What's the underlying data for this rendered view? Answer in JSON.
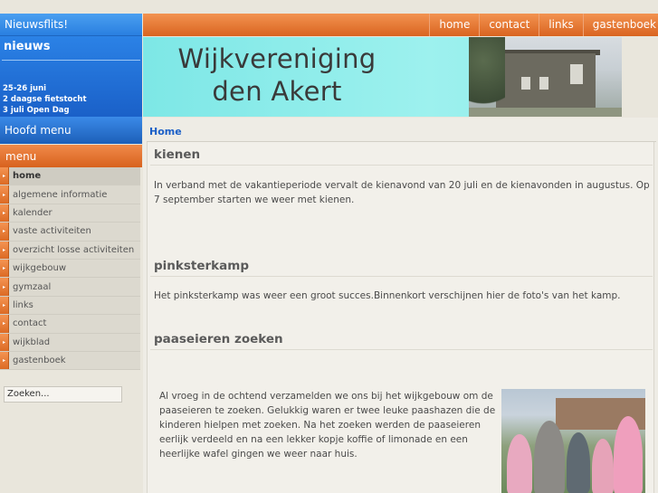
{
  "sidebar": {
    "flits_label": "Nieuwsflits!",
    "news_title": "nieuws",
    "news_items": [
      "25-26  juni",
      "2 daagse fietstocht",
      "3 juli Open Dag"
    ],
    "hoofdmenu_label": "Hoofd menu",
    "menu_label": "menu",
    "menu_items": [
      {
        "label": "home"
      },
      {
        "label": "algemene informatie"
      },
      {
        "label": "kalender"
      },
      {
        "label": "vaste activiteiten"
      },
      {
        "label": "overzicht losse activiteiten"
      },
      {
        "label": "wijkgebouw"
      },
      {
        "label": "gymzaal"
      },
      {
        "label": "links"
      },
      {
        "label": "contact"
      },
      {
        "label": "wijkblad"
      },
      {
        "label": "gastenboek"
      }
    ],
    "search_value": "Zoeken..."
  },
  "nav": {
    "items": [
      "home",
      "contact",
      "links",
      "gastenboek"
    ]
  },
  "banner": {
    "title_line1": "Wijkvereniging",
    "title_line2": "den Akert"
  },
  "content": {
    "breadcrumb": "Home",
    "sections": [
      {
        "title": "kienen",
        "text": "In verband met de vakantieperiode vervalt de kienavond van 20 juli en de kienavonden in augustus. Op 7 september starten we weer met kienen."
      },
      {
        "title": "pinksterkamp",
        "text": "Het pinksterkamp was weer een groot succes.Binnenkort verschijnen hier de foto's van het kamp."
      },
      {
        "title": "paaseieren zoeken",
        "text": "Al vroeg in de ochtend verzamelden we ons bij het wijkgebouw om de paaseieren te zoeken. Gelukkig waren er twee leuke paashazen die de kinderen hielpen met zoeken. Na het zoeken werden de paaseieren eerlijk verdeeld en na een lekker kopje koffie of limonade en een heerlijke wafel gingen we weer naar huis."
      }
    ]
  },
  "colors": {
    "orange": "#d96420",
    "blue": "#2a7fe0",
    "link": "#1b5fc7"
  }
}
